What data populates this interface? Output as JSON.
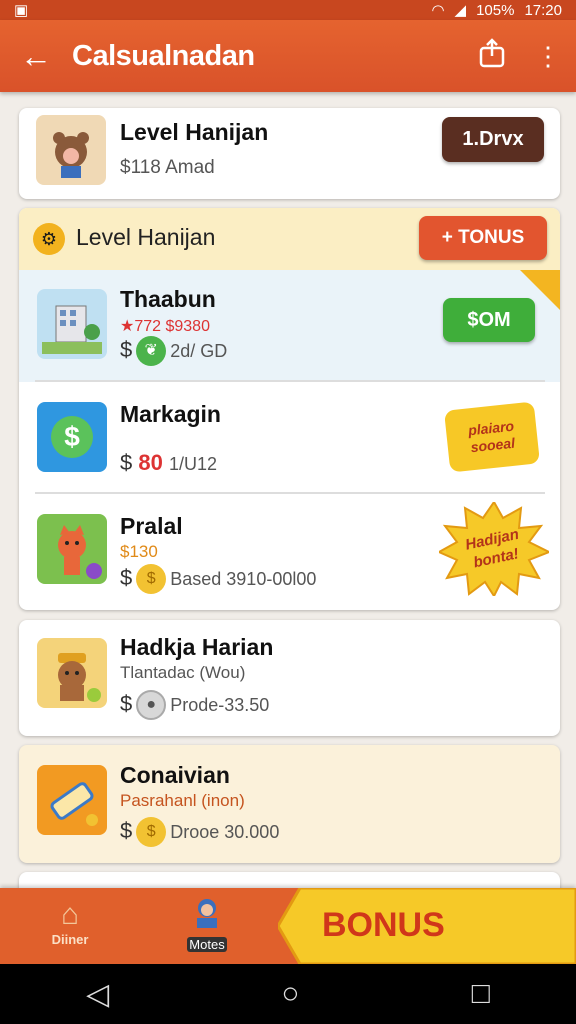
{
  "status": {
    "left_icon": "image-icon",
    "battery": "105%",
    "time": "17:20"
  },
  "appbar": {
    "title": "Calsualnadan"
  },
  "featured": {
    "name": "Level Hanijan",
    "price": "$118 Amad",
    "button": "1.Drvx"
  },
  "section": {
    "title": "Level Hanijan",
    "button": "+ TONUS"
  },
  "items": [
    {
      "name": "Thaabun",
      "detail": "★772 $9380",
      "price_prefix": "$",
      "price": "2d/ GD",
      "button": "$OM"
    },
    {
      "name": "Markagin",
      "price_prefix": "$",
      "price_red": "80",
      "price": "1/U12",
      "badge": "plaiaro\nsooeal"
    },
    {
      "name": "Pralal",
      "detail": "$130",
      "price_prefix": "$",
      "price": "Based 3910-00l00",
      "badge": "Hadijan\nbonta!"
    }
  ],
  "card2": {
    "name": "Hadkja Harian",
    "detail": "Tlantadac (Wou)",
    "price_prefix": "$",
    "price": "Prode-33.50"
  },
  "card3": {
    "name": "Conaivian",
    "detail": "Pasrahanl (inon)",
    "price_prefix": "$",
    "price": "Drooe 30.000"
  },
  "bottom": {
    "home_label": "Diiner",
    "mid_label": "Motes",
    "bonus": "BONUS"
  },
  "colors": {
    "accent": "#e0602c",
    "green": "#3fae3a",
    "red_button": "#e2552f",
    "dark_button": "#5a2e21",
    "bonus_yellow": "#f6c928"
  }
}
